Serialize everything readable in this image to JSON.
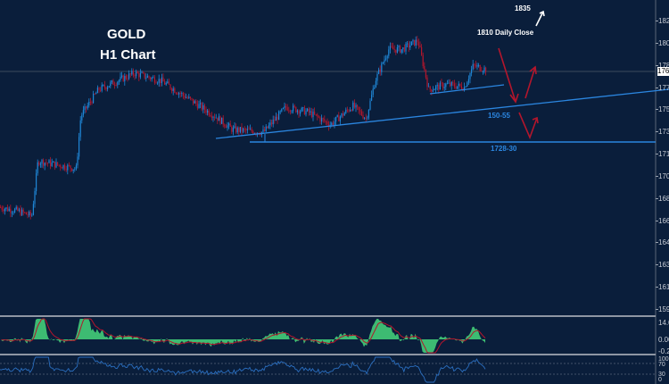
{
  "title": {
    "symbol": "GOLD",
    "timeframe": "H1 Chart"
  },
  "annotations": {
    "target_top": "1835",
    "daily_close": "1810 Daily Close",
    "zone": "150-55",
    "support": "1728-30"
  },
  "colors": {
    "background": "#0a1e3b",
    "bull": "#1f86d6",
    "bear": "#b3162c",
    "trendline": "#2b86e0",
    "macd_fill": "#3dbb72",
    "signal": "#b3162c",
    "rsi": "#2b6fc0"
  },
  "chart_data": {
    "type": "candlestick",
    "price_ticks": [
      "182",
      "180",
      "178",
      "177",
      "175",
      "173",
      "171",
      "170",
      "168",
      "166",
      "164",
      "163",
      "161",
      "159"
    ],
    "current_price_label": "176",
    "ylim": [
      159,
      182
    ],
    "price_path": [
      [
        0,
        167.1
      ],
      [
        20,
        166.8
      ],
      [
        35,
        166.4
      ],
      [
        42,
        170.8
      ],
      [
        85,
        170.2
      ],
      [
        90,
        174.4
      ],
      [
        110,
        176.5
      ],
      [
        150,
        177.8
      ],
      [
        180,
        177.2
      ],
      [
        210,
        175.8
      ],
      [
        240,
        174.4
      ],
      [
        260,
        173.3
      ],
      [
        295,
        173.1
      ],
      [
        320,
        175.1
      ],
      [
        345,
        174.7
      ],
      [
        370,
        173.7
      ],
      [
        395,
        175.2
      ],
      [
        410,
        174.2
      ],
      [
        420,
        177.2
      ],
      [
        435,
        179.7
      ],
      [
        450,
        179.7
      ],
      [
        468,
        180.4
      ],
      [
        480,
        176.5
      ],
      [
        500,
        176.9
      ],
      [
        520,
        176.7
      ],
      [
        530,
        178.4
      ],
      [
        545,
        178.1
      ]
    ],
    "macd_ticks": [
      "14.0",
      "0.00",
      "-0.2"
    ],
    "rsi_ticks": [
      "100",
      "70",
      "30",
      "0"
    ]
  }
}
